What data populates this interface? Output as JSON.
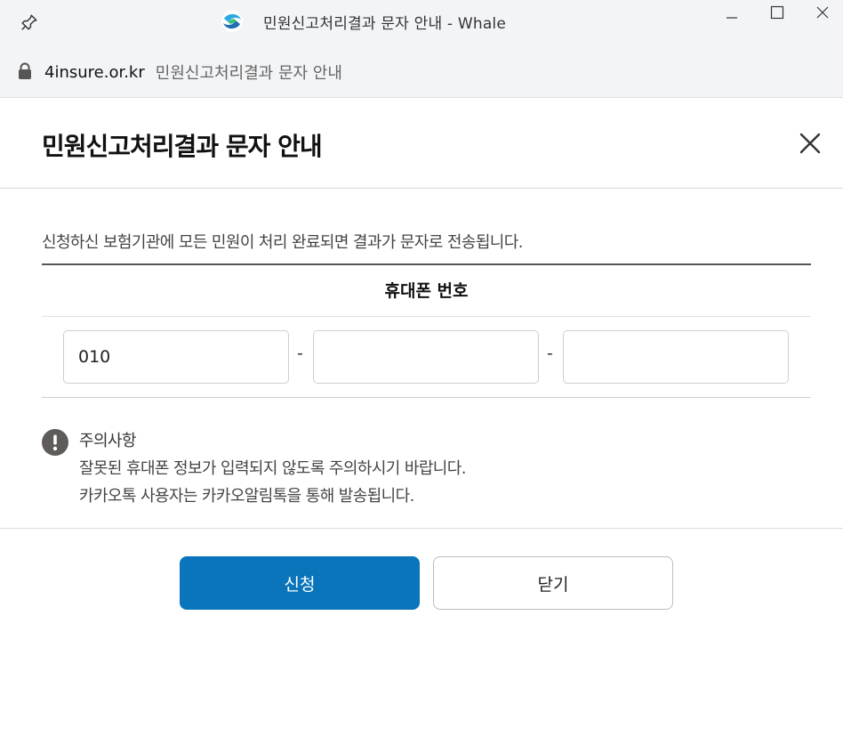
{
  "window": {
    "title": "민원신고처리결과 문자 안내 - Whale"
  },
  "address_bar": {
    "domain": "4insure.or.kr",
    "page_title": "민원신고처리결과 문자 안내"
  },
  "modal": {
    "title": "민원신고처리결과 문자 안내",
    "description": "신청하신 보험기관에 모든 민원이 처리 완료되면 결과가 문자로 전송됩니다.",
    "phone_label": "휴대폰 번호",
    "phone": {
      "part1": "010",
      "part2": "",
      "part3": "",
      "separator": "-"
    },
    "notice": {
      "title": "주의사항",
      "lines": [
        "잘못된 휴대폰 정보가 입력되지 않도록 주의하시기 바랍니다.",
        "카카오톡 사용자는 카카오알림톡을 통해 발송됩니다."
      ]
    },
    "buttons": {
      "apply": "신청",
      "close": "닫기"
    }
  },
  "colors": {
    "primary_button": "#0a75bb",
    "notice_icon": "#5f5b5b",
    "chrome_bg": "#f3f4f6"
  },
  "icons": {
    "pin": "pin-icon",
    "browser_logo": "whale-logo-icon",
    "lock": "lock-icon",
    "close": "close-icon",
    "notice": "exclamation-icon"
  }
}
